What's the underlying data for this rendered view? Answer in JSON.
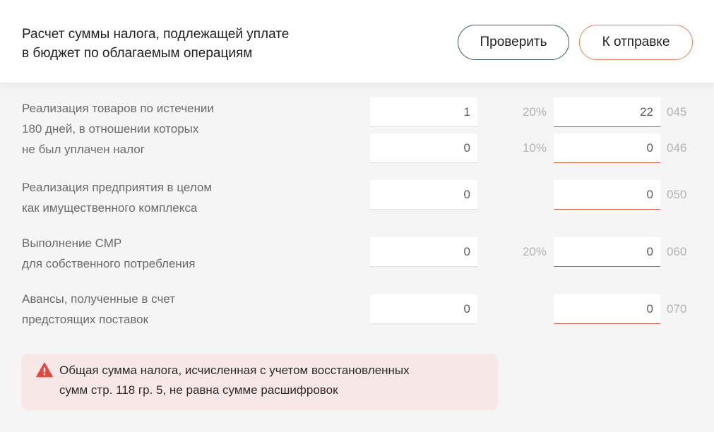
{
  "header": {
    "title_lines": [
      "Расчет суммы налога, подлежащей уплате",
      "в бюджет по облагаемым операциям"
    ],
    "check_label": "Проверить",
    "send_label": "К отправке"
  },
  "rows": [
    {
      "qty": "1",
      "rate": "20%",
      "tax": "22",
      "code": "045"
    },
    {
      "qty": "0",
      "rate": "10%",
      "tax": "0",
      "code": "046"
    },
    {
      "qty": "0",
      "rate": "",
      "tax": "0",
      "code": "050"
    },
    {
      "qty": "0",
      "rate": "20%",
      "tax": "0",
      "code": "060"
    },
    {
      "qty": "0",
      "rate": "",
      "tax": "0",
      "code": "070"
    }
  ],
  "sections": [
    {
      "lines": [
        "Реализация товаров по истечении",
        "180 дней, в отношении которых",
        "не был уплачен налог"
      ]
    },
    {
      "lines": [
        "Реализация предприятия в целом",
        "как имущественного комплекса"
      ]
    },
    {
      "lines": [
        "Выполнение СМР",
        "для собственного потребления"
      ]
    },
    {
      "lines": [
        "Авансы, полученные в счет",
        "предстоящих поставок"
      ]
    }
  ],
  "alert": {
    "icon": "warning-icon",
    "color": "#e04a3f",
    "lines": [
      "Общая сумма налога, исчисленная с учетом восстановленных",
      "сумм стр. 118 гр. 5, не равна сумме расшифровок"
    ]
  },
  "colors": {
    "accent_primary": "#3b5670",
    "accent_send": "#e0825a",
    "underline_error": "#d9604a",
    "alert_bg": "#f7e7e7"
  }
}
